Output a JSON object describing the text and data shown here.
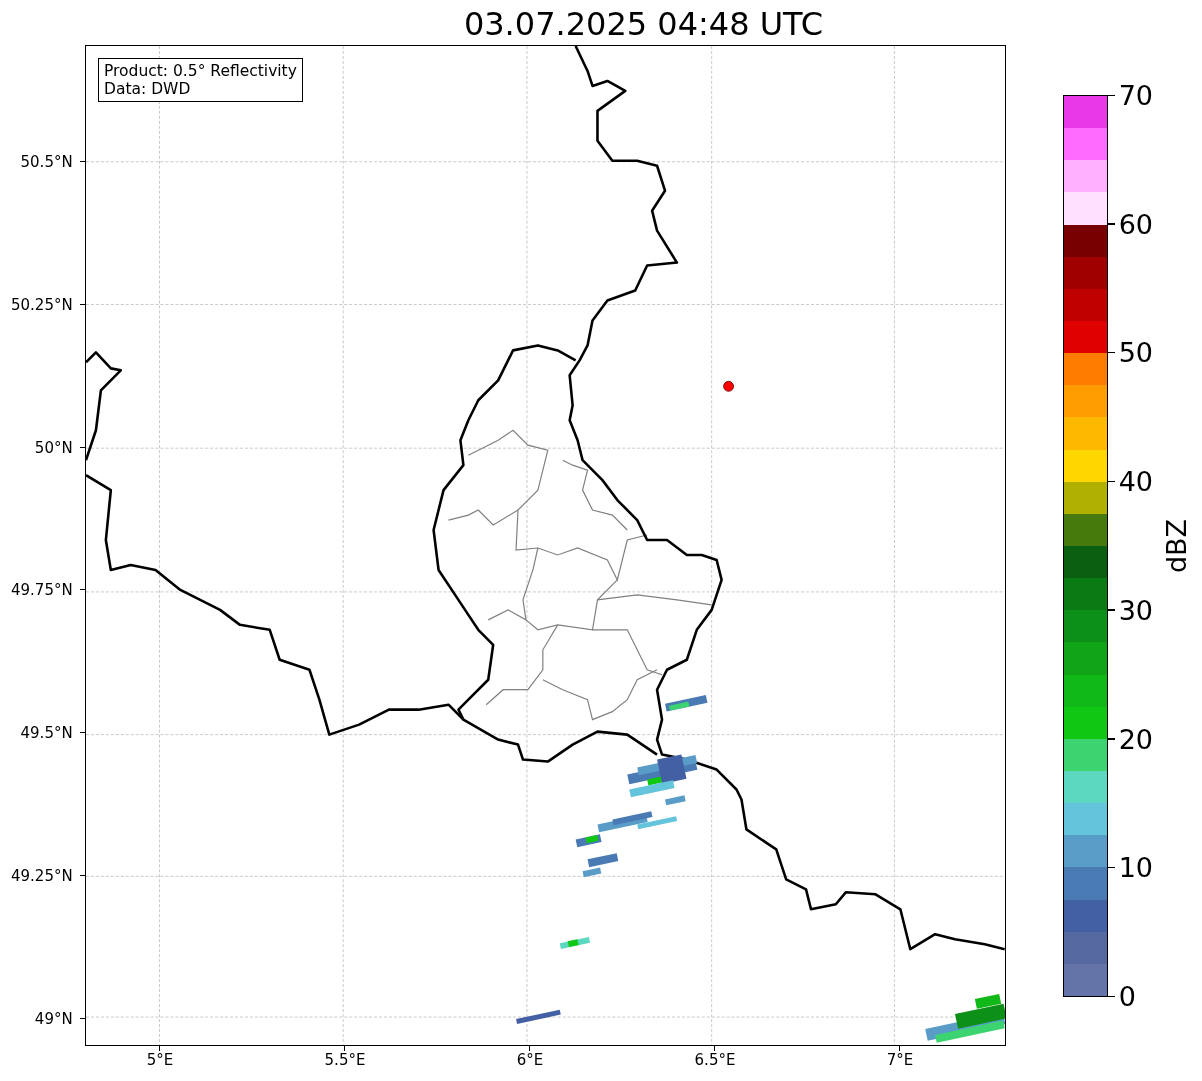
{
  "title": "03.07.2025 04:48 UTC",
  "map": {
    "legend": [
      "Product: 0.5° Reflectivity",
      "Data: DWD"
    ],
    "xticks": [
      "5°E",
      "5.5°E",
      "6°E",
      "6.5°E",
      "7°E"
    ],
    "yticks": [
      "50.5°N",
      "50.25°N",
      "50°N",
      "49.75°N",
      "49.5°N",
      "49.25°N",
      "49°N"
    ]
  },
  "colorbar": {
    "label": "dBZ",
    "ticks": [
      "70",
      "60",
      "50",
      "40",
      "30",
      "20",
      "10",
      "0"
    ],
    "bins": [
      {
        "color": "#6474a8"
      },
      {
        "color": "#5568a0"
      },
      {
        "color": "#4460a4"
      },
      {
        "color": "#4a7ab4"
      },
      {
        "color": "#5a9cc8"
      },
      {
        "color": "#64c4dc"
      },
      {
        "color": "#5cd8c0"
      },
      {
        "color": "#3cd470"
      },
      {
        "color": "#10c814"
      },
      {
        "color": "#10b818"
      },
      {
        "color": "#10a418"
      },
      {
        "color": "#0c9018"
      },
      {
        "color": "#0a7a12"
      },
      {
        "color": "#0a6010"
      },
      {
        "color": "#467a0c"
      },
      {
        "color": "#b0b000"
      },
      {
        "color": "#ffd700"
      },
      {
        "color": "#ffb800"
      },
      {
        "color": "#ff9c00"
      },
      {
        "color": "#ff7c00"
      },
      {
        "color": "#e00000"
      },
      {
        "color": "#c00000"
      },
      {
        "color": "#a00000"
      },
      {
        "color": "#780000"
      },
      {
        "color": "#ffe0ff"
      },
      {
        "color": "#ffb0ff"
      },
      {
        "color": "#ff6cff"
      },
      {
        "color": "#e838e8"
      }
    ]
  }
}
